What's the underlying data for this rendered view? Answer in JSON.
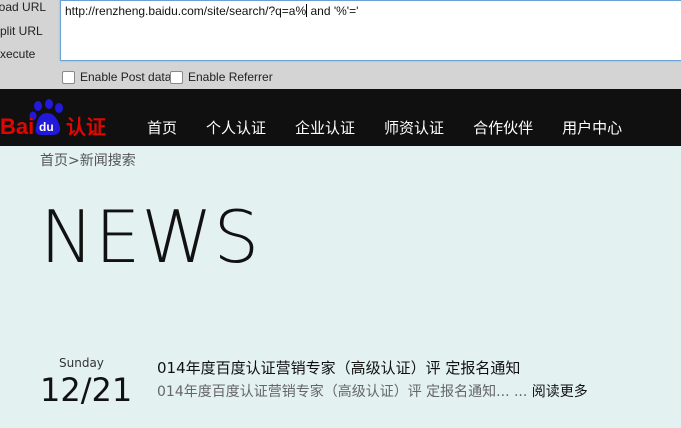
{
  "hackbar": {
    "load_label": "Load URL",
    "split_label": "Split URL",
    "execute_label": "Execute",
    "url_before_caret": "http://renzheng.baidu.com/site/search/?q=a%",
    "url_after_caret": " and '%'='",
    "post_label": "Enable Post data",
    "referrer_label": "Enable Referrer"
  },
  "logo": {
    "bai": "Bai",
    "du": "du",
    "suffix": "认证",
    "red": "#e10602",
    "blue": "#2319dc"
  },
  "nav": {
    "items": [
      "首页",
      "个人认证",
      "企业认证",
      "师资认证",
      "合作伙伴",
      "用户中心"
    ]
  },
  "breadcrumb": "首页>新闻搜索",
  "page_title": "NEWS",
  "article": {
    "day": "Sunday",
    "date": "12/21",
    "title": "014年度百度认证营销专家（高级认证）评 定报名通知",
    "summary": "014年度百度认证营销专家（高级认证）评 定报名通知... ...",
    "read_more": "阅读更多"
  }
}
